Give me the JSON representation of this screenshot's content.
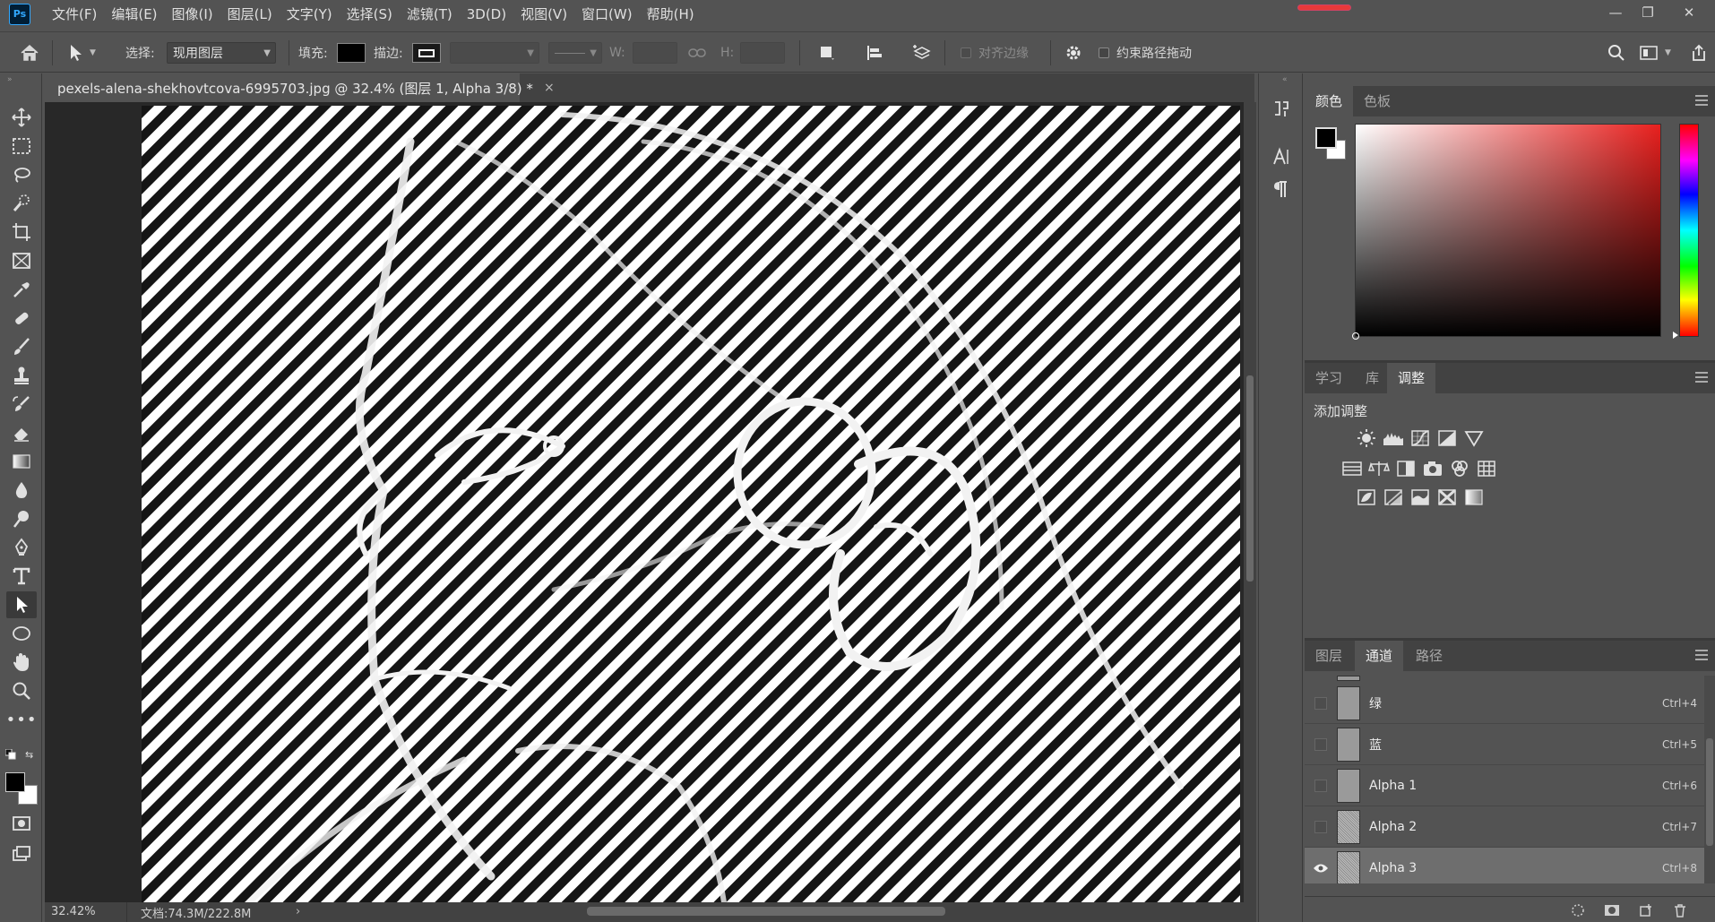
{
  "app": {
    "logo_text": "Ps"
  },
  "menu": [
    "文件(F)",
    "编辑(E)",
    "图像(I)",
    "图层(L)",
    "文字(Y)",
    "选择(S)",
    "滤镜(T)",
    "3D(D)",
    "视图(V)",
    "窗口(W)",
    "帮助(H)"
  ],
  "window_controls": {
    "minimize": "—",
    "restore": "❐",
    "close": "✕"
  },
  "options_bar": {
    "select_label": "选择:",
    "select_value": "现用图层",
    "fill_label": "填充:",
    "stroke_label": "描边:",
    "w_label": "W:",
    "h_label": "H:",
    "align_edges_label": "对齐边缘",
    "constrain_path_label": "约束路径拖动"
  },
  "document": {
    "tab_title": "pexels-alena-shekhovtcova-6995703.jpg @ 32.4% (图层 1, Alpha 3/8) *",
    "tab_close": "×"
  },
  "status": {
    "zoom": "32.42%",
    "doc_size": "文档:74.3M/222.8M",
    "arrow": "›"
  },
  "color_panel": {
    "tabs": [
      "颜色",
      "色板"
    ],
    "active_tab": 0
  },
  "adjust_panel": {
    "tabs": [
      "学习",
      "库",
      "调整"
    ],
    "active_tab": 2,
    "heading": "添加调整",
    "rows": [
      [
        "brightness-contrast-icon",
        "levels-icon",
        "curves-icon",
        "exposure-icon",
        "vibrance-icon"
      ],
      [
        "hue-saturation-icon",
        "color-balance-icon",
        "black-white-icon",
        "photo-filter-icon",
        "channel-mixer-icon",
        "color-lookup-icon"
      ],
      [
        "invert-icon",
        "posterize-icon",
        "threshold-icon",
        "gradient-map-icon",
        "selective-color-icon"
      ]
    ]
  },
  "channels_panel": {
    "tabs": [
      "图层",
      "通道",
      "路径"
    ],
    "active_tab": 1,
    "channels": [
      {
        "name": "绿",
        "shortcut": "Ctrl+4",
        "visible": false,
        "selected": false,
        "thumb": "plain"
      },
      {
        "name": "蓝",
        "shortcut": "Ctrl+5",
        "visible": false,
        "selected": false,
        "thumb": "plain"
      },
      {
        "name": "Alpha 1",
        "shortcut": "Ctrl+6",
        "visible": false,
        "selected": false,
        "thumb": "plain"
      },
      {
        "name": "Alpha 2",
        "shortcut": "Ctrl+7",
        "visible": false,
        "selected": false,
        "thumb": "noise"
      },
      {
        "name": "Alpha 3",
        "shortcut": "Ctrl+8",
        "visible": true,
        "selected": true,
        "thumb": "noise"
      }
    ]
  },
  "colors": {
    "foreground": "#000000",
    "background": "#ffffff",
    "accent": "#31a8ff"
  }
}
